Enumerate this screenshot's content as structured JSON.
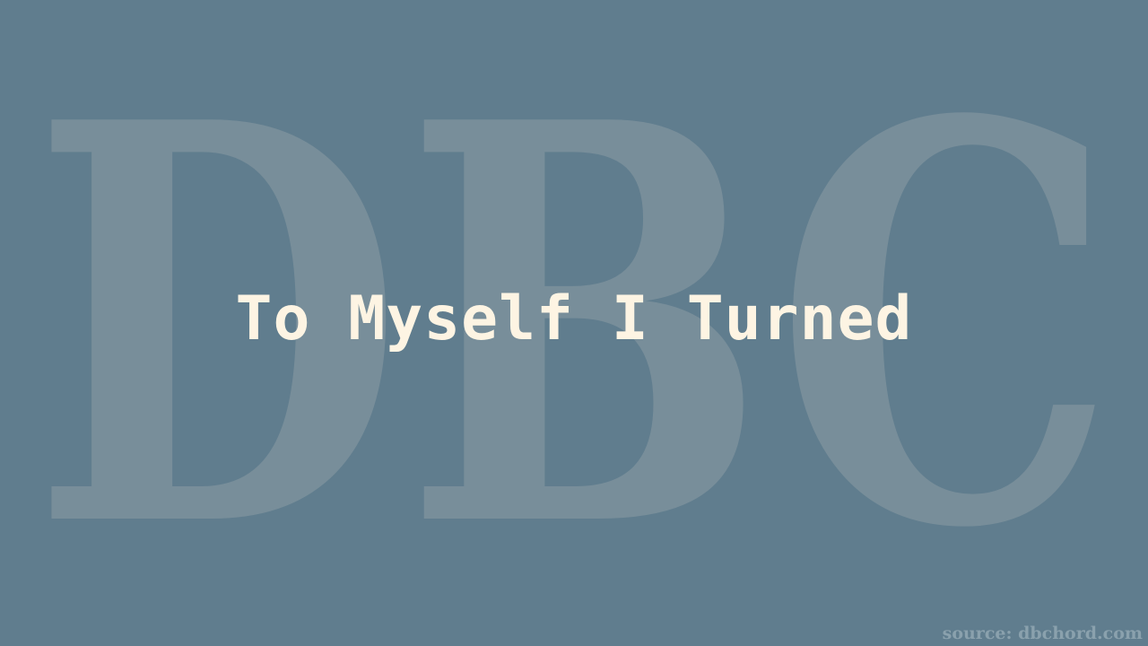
{
  "background_color": "#607d8e",
  "watermark": {
    "text": "DBC",
    "color": "#788e9a"
  },
  "song": {
    "title": "To Myself I Turned",
    "color": "#fdf4e3"
  },
  "footer": {
    "source_label": "source: dbchord.com",
    "color": "#8aa1ad"
  }
}
